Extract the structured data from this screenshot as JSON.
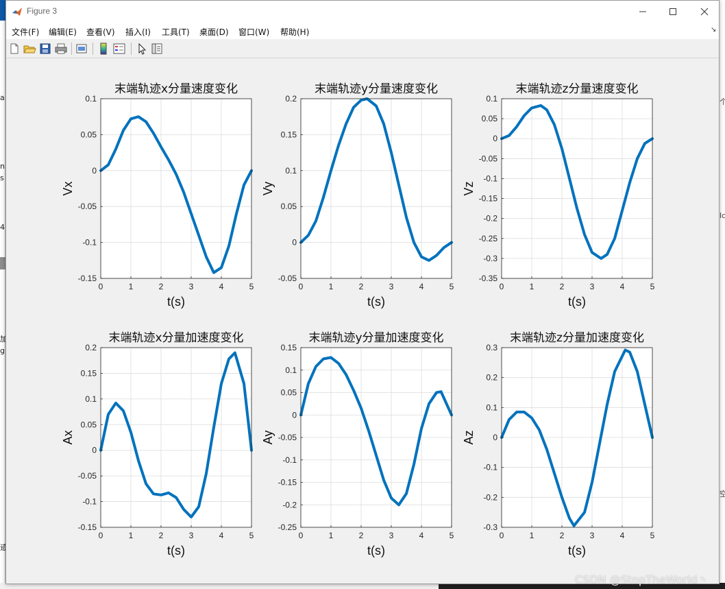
{
  "window": {
    "title": "Figure 3"
  },
  "menu": [
    {
      "label": "文件(F)"
    },
    {
      "label": "编辑(E)"
    },
    {
      "label": "查看(V)"
    },
    {
      "label": "插入(I)"
    },
    {
      "label": "工具(T)"
    },
    {
      "label": "桌面(D)"
    },
    {
      "label": "窗口(W)"
    },
    {
      "label": "帮助(H)"
    }
  ],
  "toolbar_icons": [
    "new-figure-icon",
    "open-file-icon",
    "save-icon",
    "print-icon",
    "print-preview-icon",
    "insert-colorbar-icon",
    "insert-legend-icon",
    "edit-plot-arrow-icon",
    "property-inspector-icon"
  ],
  "colors": {
    "line": "#0072bd",
    "axes_bg": "#ffffff",
    "grid": "#dcdcdc",
    "figure_bg": "#f0f0f0"
  },
  "watermark": "CSDN @StopTheWorld丶",
  "chart_data": [
    {
      "type": "line",
      "title": "末端轨迹x分量速度变化",
      "xlabel": "t(s)",
      "ylabel": "Vx",
      "xlim": [
        0,
        5
      ],
      "ylim": [
        -0.15,
        0.1
      ],
      "xticks": [
        0,
        1,
        2,
        3,
        4,
        5
      ],
      "xtick_labels": [
        "0",
        "1",
        "2",
        "3",
        "4",
        "5"
      ],
      "yticks": [
        0.1,
        0.05,
        0,
        -0.05,
        -0.1,
        -0.15
      ],
      "ytick_labels": [
        "0.1",
        "0.05",
        "0",
        "-0.05",
        "-0.1",
        "-0.15"
      ],
      "grid": true,
      "x": [
        0,
        0.25,
        0.5,
        0.75,
        1.0,
        1.25,
        1.5,
        1.75,
        2.0,
        2.25,
        2.5,
        2.75,
        3.0,
        3.25,
        3.5,
        3.75,
        4.0,
        4.25,
        4.5,
        4.75,
        5.0
      ],
      "y": [
        0,
        0.008,
        0.03,
        0.056,
        0.072,
        0.075,
        0.068,
        0.052,
        0.033,
        0.015,
        -0.005,
        -0.03,
        -0.06,
        -0.09,
        -0.12,
        -0.142,
        -0.135,
        -0.105,
        -0.06,
        -0.02,
        0
      ]
    },
    {
      "type": "line",
      "title": "末端轨迹y分量速度变化",
      "xlabel": "t(s)",
      "ylabel": "Vy",
      "xlim": [
        0,
        5
      ],
      "ylim": [
        -0.05,
        0.2
      ],
      "xticks": [
        0,
        1,
        2,
        3,
        4,
        5
      ],
      "xtick_labels": [
        "0",
        "1",
        "2",
        "3",
        "4",
        "5"
      ],
      "yticks": [
        0.2,
        0.15,
        0.1,
        0.05,
        0,
        -0.05
      ],
      "ytick_labels": [
        "0.2",
        "0.15",
        "0.1",
        "0.05",
        "0",
        "-0.05"
      ],
      "grid": true,
      "x": [
        0,
        0.25,
        0.5,
        0.75,
        1.0,
        1.25,
        1.5,
        1.75,
        2.0,
        2.2,
        2.5,
        2.75,
        3.0,
        3.25,
        3.5,
        3.75,
        4.0,
        4.25,
        4.5,
        4.75,
        5.0
      ],
      "y": [
        0,
        0.01,
        0.03,
        0.063,
        0.1,
        0.135,
        0.165,
        0.188,
        0.198,
        0.2,
        0.19,
        0.165,
        0.125,
        0.08,
        0.035,
        0,
        -0.02,
        -0.025,
        -0.018,
        -0.007,
        0
      ]
    },
    {
      "type": "line",
      "title": "末端轨迹z分量速度变化",
      "xlabel": "t(s)",
      "ylabel": "Vz",
      "xlim": [
        0,
        5
      ],
      "ylim": [
        -0.35,
        0.1
      ],
      "xticks": [
        0,
        1,
        2,
        3,
        4,
        5
      ],
      "xtick_labels": [
        "0",
        "1",
        "2",
        "3",
        "4",
        "5"
      ],
      "yticks": [
        0.1,
        0.05,
        0,
        -0.05,
        -0.1,
        -0.15,
        -0.2,
        -0.25,
        -0.3,
        -0.35
      ],
      "ytick_labels": [
        "0.1",
        "0.05",
        "0",
        "-0.05",
        "-0.1",
        "-0.15",
        "-0.2",
        "-0.25",
        "-0.3",
        "-0.35"
      ],
      "grid": true,
      "x": [
        0,
        0.25,
        0.5,
        0.75,
        1.0,
        1.3,
        1.5,
        1.75,
        2.0,
        2.25,
        2.5,
        2.75,
        3.0,
        3.3,
        3.5,
        3.75,
        4.0,
        4.25,
        4.5,
        4.75,
        5.0
      ],
      "y": [
        0,
        0.008,
        0.03,
        0.058,
        0.077,
        0.083,
        0.072,
        0.035,
        -0.025,
        -0.1,
        -0.175,
        -0.24,
        -0.285,
        -0.3,
        -0.29,
        -0.25,
        -0.18,
        -0.11,
        -0.05,
        -0.012,
        0
      ]
    },
    {
      "type": "line",
      "title": "末端轨迹x分量加速度变化",
      "xlabel": "t(s)",
      "ylabel": "Ax",
      "xlim": [
        0,
        5
      ],
      "ylim": [
        -0.15,
        0.2
      ],
      "xticks": [
        0,
        1,
        2,
        3,
        4,
        5
      ],
      "xtick_labels": [
        "0",
        "1",
        "2",
        "3",
        "4",
        "5"
      ],
      "yticks": [
        0.2,
        0.15,
        0.1,
        0.05,
        0,
        -0.05,
        -0.1,
        -0.15
      ],
      "ytick_labels": [
        "0.2",
        "0.15",
        "0.1",
        "0.05",
        "0",
        "-0.05",
        "-0.1",
        "-0.15"
      ],
      "grid": true,
      "x": [
        0,
        0.25,
        0.5,
        0.75,
        1.0,
        1.25,
        1.5,
        1.75,
        2.0,
        2.25,
        2.5,
        2.75,
        3.0,
        3.25,
        3.5,
        3.75,
        4.0,
        4.25,
        4.45,
        4.75,
        5.0
      ],
      "y": [
        0,
        0.07,
        0.092,
        0.077,
        0.035,
        -0.02,
        -0.065,
        -0.085,
        -0.087,
        -0.083,
        -0.092,
        -0.115,
        -0.13,
        -0.11,
        -0.045,
        0.045,
        0.13,
        0.178,
        0.19,
        0.13,
        0
      ]
    },
    {
      "type": "line",
      "title": "末端轨迹y分量加速度变化",
      "xlabel": "t(s)",
      "ylabel": "Ay",
      "xlim": [
        0,
        5
      ],
      "ylim": [
        -0.25,
        0.15
      ],
      "xticks": [
        0,
        1,
        2,
        3,
        4,
        5
      ],
      "xtick_labels": [
        "0",
        "1",
        "2",
        "3",
        "4",
        "5"
      ],
      "yticks": [
        0.15,
        0.1,
        0.05,
        0,
        -0.05,
        -0.1,
        -0.15,
        -0.2,
        -0.25
      ],
      "ytick_labels": [
        "0.15",
        "0.1",
        "0.05",
        "0",
        "-0.05",
        "-0.1",
        "-0.15",
        "-0.2",
        "-0.25"
      ],
      "grid": true,
      "x": [
        0,
        0.25,
        0.5,
        0.75,
        1.0,
        1.25,
        1.5,
        1.75,
        2.0,
        2.25,
        2.5,
        2.75,
        3.0,
        3.25,
        3.5,
        3.75,
        4.0,
        4.25,
        4.5,
        4.65,
        5.0
      ],
      "y": [
        0,
        0.07,
        0.108,
        0.125,
        0.128,
        0.115,
        0.09,
        0.055,
        0.015,
        -0.035,
        -0.09,
        -0.145,
        -0.185,
        -0.2,
        -0.175,
        -0.11,
        -0.03,
        0.025,
        0.05,
        0.052,
        0
      ]
    },
    {
      "type": "line",
      "title": "末端轨迹z分量加速度变化",
      "xlabel": "t(s)",
      "ylabel": "Az",
      "xlim": [
        0,
        5
      ],
      "ylim": [
        -0.3,
        0.3
      ],
      "xticks": [
        0,
        1,
        2,
        3,
        4,
        5
      ],
      "xtick_labels": [
        "0",
        "1",
        "2",
        "3",
        "4",
        "5"
      ],
      "yticks": [
        0.3,
        0.2,
        0.1,
        0,
        -0.1,
        -0.2,
        -0.3
      ],
      "ytick_labels": [
        "0.3",
        "0.2",
        "0.1",
        "0",
        "-0.1",
        "-0.2",
        "-0.3"
      ],
      "grid": true,
      "x": [
        0,
        0.25,
        0.5,
        0.75,
        1.0,
        1.25,
        1.5,
        1.75,
        2.0,
        2.25,
        2.4,
        2.75,
        3.0,
        3.25,
        3.5,
        3.75,
        4.1,
        4.25,
        4.5,
        4.75,
        5.0
      ],
      "y": [
        0,
        0.06,
        0.085,
        0.085,
        0.065,
        0.025,
        -0.04,
        -0.12,
        -0.2,
        -0.27,
        -0.295,
        -0.25,
        -0.15,
        -0.02,
        0.11,
        0.22,
        0.292,
        0.285,
        0.22,
        0.11,
        0
      ]
    }
  ]
}
